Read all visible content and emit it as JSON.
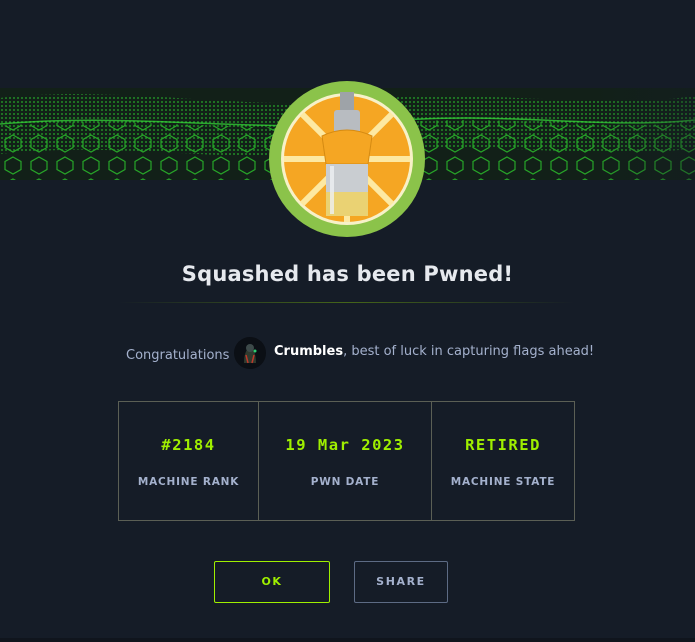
{
  "dialog": {
    "title": "Squashed has been Pwned!",
    "congrats_label": "Congratulations",
    "username": "Crumbles",
    "message_suffix": ", best of luck in capturing flags ahead!"
  },
  "stats": [
    {
      "value": "#2184",
      "label": "MACHINE RANK"
    },
    {
      "value": "19 Mar 2023",
      "label": "PWN DATE"
    },
    {
      "value": "RETIRED",
      "label": "MACHINE STATE"
    }
  ],
  "buttons": {
    "ok_label": "OK",
    "share_label": "SHARE"
  },
  "colors": {
    "background": "#151c27",
    "accent_green": "#9fef00",
    "muted_text": "#a4b1cd",
    "logo_ring": "#8bc34a",
    "logo_fill": "#f5a623"
  },
  "icons": {
    "banner": "green-hex-wave-banner",
    "machine_logo": "orange-slice-logo",
    "avatar": "user-avatar"
  }
}
